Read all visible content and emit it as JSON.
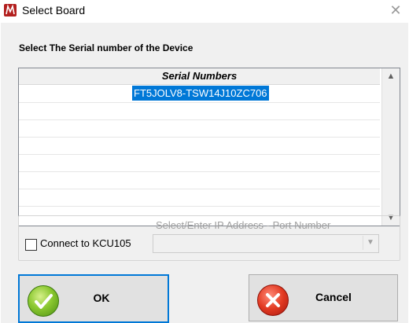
{
  "window": {
    "title": "Select Board",
    "close_glyph": "✕"
  },
  "heading": "Select The Serial number of the Device",
  "grid": {
    "column_header": "Serial Numbers",
    "rows": [
      "FT5JOLV8-TSW14J10ZC706",
      "",
      "",
      "",
      "",
      "",
      ""
    ],
    "selected_row": 0
  },
  "connection": {
    "ip_label": "Select/Enter IP Address - Port Number",
    "checkbox_label": "Connect to KCU105",
    "checkbox_checked": false,
    "ip_value": ""
  },
  "buttons": {
    "ok_label": "OK",
    "cancel_label": "Cancel"
  },
  "icons": {
    "app": "app-logo-icon",
    "ok": "checkmark-icon",
    "cancel": "x-circle-icon"
  }
}
